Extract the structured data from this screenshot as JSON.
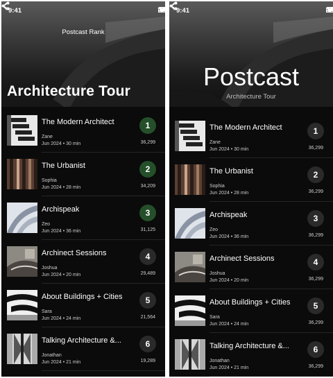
{
  "status": {
    "time": "9:41"
  },
  "left": {
    "nav_title": "Postcast Rank",
    "big_title": "Architecture Tour"
  },
  "right": {
    "brand": "Postcast",
    "subtitle": "Architecture Tour"
  },
  "icons": {
    "back": "chevron-left-icon",
    "share": "share-icon",
    "signal": "signal-icon",
    "wifi": "wifi-icon",
    "battery": "battery-icon"
  },
  "colors": {
    "top_rank_badge": "#244f2a",
    "rank_badge": "#2a2a2a",
    "background": "#0b0b0b"
  },
  "podcasts": [
    {
      "title": "The Modern Architect",
      "author": "Zane",
      "date": "Jun 2024",
      "duration": "30 min",
      "rank": "1"
    },
    {
      "title": "The Urbanist",
      "author": "Sophia",
      "date": "Jun 2024",
      "duration": "28 min",
      "rank": "2"
    },
    {
      "title": "Archispeak",
      "author": "Zeo",
      "date": "Jun 2024",
      "duration": "36 min",
      "rank": "3"
    },
    {
      "title": "Archinect Sessions",
      "author": "Joshua",
      "date": "Jun 2024",
      "duration": "20 min",
      "rank": "4"
    },
    {
      "title": "About Buildings + Cities",
      "author": "Sara",
      "date": "Jun 2024",
      "duration": "24 min",
      "rank": "5"
    },
    {
      "title": "Talking Architecture &...",
      "author": "Jonathan",
      "date": "Jun 2024",
      "duration": "21 min",
      "rank": "6"
    }
  ],
  "left_counts": [
    "36,299",
    "34,209",
    "31,125",
    "29,489",
    "21,564",
    "19,289"
  ],
  "right_counts": [
    "36,299",
    "36,299",
    "36,299",
    "36,299",
    "36,299",
    "36,299"
  ]
}
